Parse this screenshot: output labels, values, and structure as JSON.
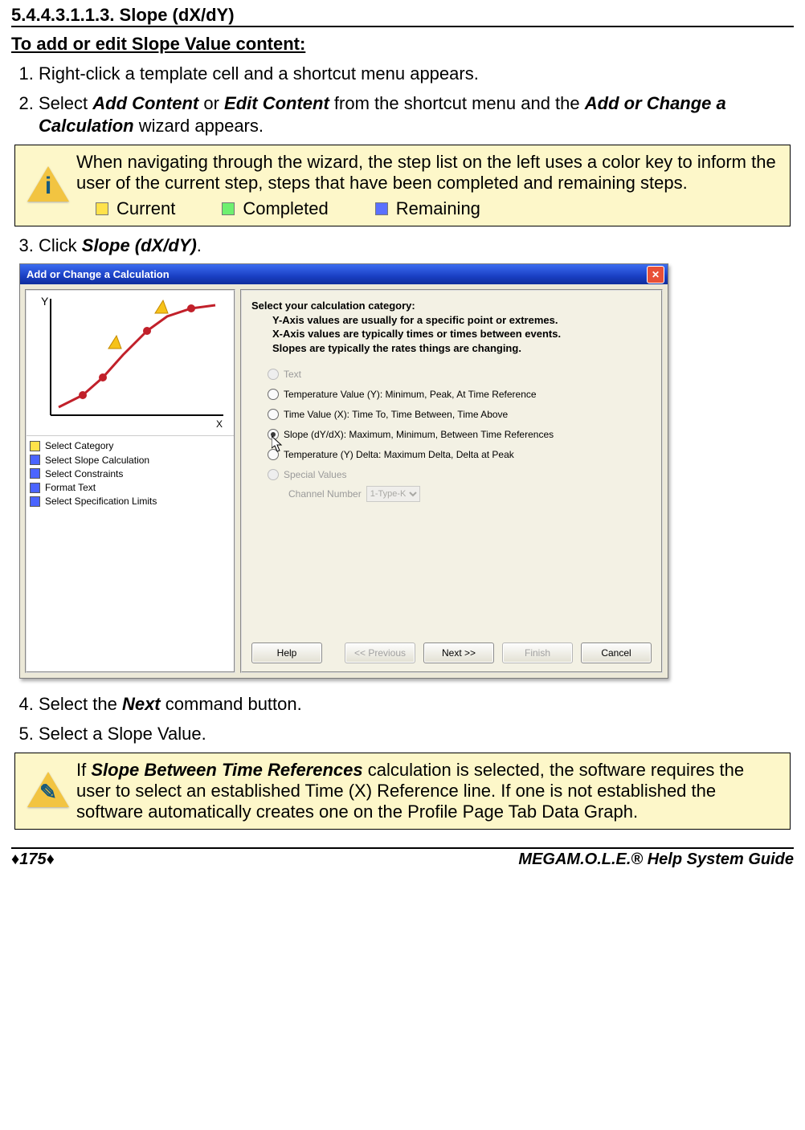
{
  "section_number_title": "5.4.4.3.1.1.3. Slope (dX/dY)",
  "subheading": "To add or edit Slope Value content:",
  "steps": [
    {
      "num": "1)",
      "text": "Right-click a template cell and a shortcut menu appears."
    },
    {
      "num": "2)",
      "prefix": "Select ",
      "bi1": "Add Content",
      "mid1": " or ",
      "bi2": "Edit Content",
      "mid2": " from the shortcut menu and the ",
      "bi3": "Add or Change a Calculation",
      "suffix": " wizard appears."
    },
    {
      "num": "3)",
      "prefix": "Click ",
      "bi1": "Slope (dX/dY)",
      "suffix": "."
    },
    {
      "num": "4)",
      "prefix": "Select the ",
      "bi1": "Next",
      "suffix": " command button."
    },
    {
      "num": "5)",
      "text": "Select a Slope Value."
    }
  ],
  "callout1": {
    "para": "When navigating through the wizard, the step list on the left uses a color key to inform the user of the current step, steps that have been completed and remaining steps.",
    "legend": {
      "current": "Current",
      "completed": "Completed",
      "remaining": "Remaining"
    }
  },
  "callout2": {
    "prefix": "If ",
    "bi": "Slope Between Time References",
    "rest": " calculation is selected, the software requires the user to select an established Time (X) Reference line. If one is not established the software automatically creates one on the Profile Page Tab Data Graph."
  },
  "window": {
    "title": "Add or Change a Calculation",
    "steps": [
      {
        "state": "cur",
        "label": "Select Category"
      },
      {
        "state": "rem",
        "label": "Select Slope Calculation"
      },
      {
        "state": "rem",
        "label": "Select Constraints"
      },
      {
        "state": "rem",
        "label": "Format Text"
      },
      {
        "state": "rem",
        "label": "Select Specification Limits"
      }
    ],
    "prompt": {
      "l1": "Select your calculation category:",
      "l2": "Y-Axis values are usually for a specific point or extremes.",
      "l3": "X-Axis values are typically times or times between events.",
      "l4": "Slopes are typically the rates things are changing."
    },
    "radios": {
      "text": "Text",
      "tempY": "Temperature Value (Y):  Minimum, Peak, At Time Reference",
      "timeX": "Time Value (X):  Time To, Time Between, Time Above",
      "slope": "Slope (dY/dX):  Maximum, Minimum, Between Time References",
      "delta": "Temperature (Y) Delta:  Maximum Delta, Delta at Peak",
      "special": "Special  Values",
      "channel_label": "Channel Number",
      "channel_value": "1-Type-K"
    },
    "buttons": {
      "help": "Help",
      "prev": "<< Previous",
      "next": "Next >>",
      "finish": "Finish",
      "cancel": "Cancel"
    }
  },
  "footer": {
    "page": "♦175♦",
    "brand_bold": "MEGA",
    "brand_rest": "M.O.L.E.® Help System Guide"
  }
}
